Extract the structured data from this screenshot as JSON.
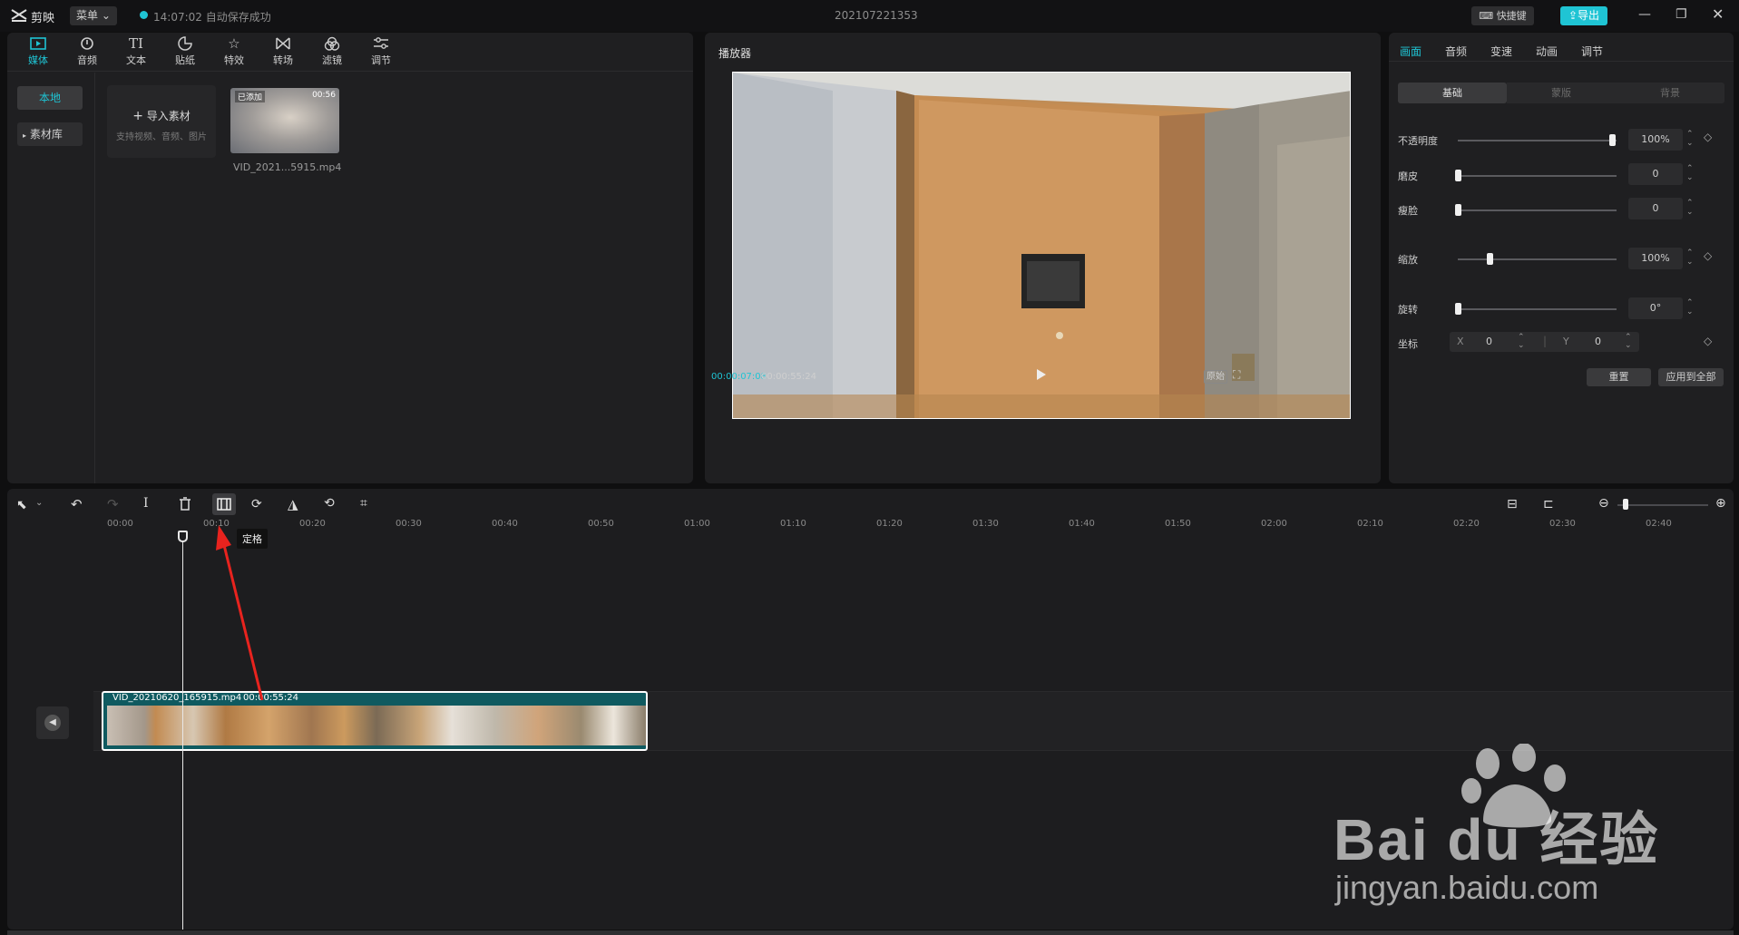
{
  "app": {
    "name": "剪映",
    "menu_label": "菜单",
    "autosave": "14:07:02 自动保存成功",
    "project_name": "202107221353",
    "shortcut_label": "快捷键",
    "export_label": "导出"
  },
  "media_tabs": [
    {
      "label": "媒体",
      "icon": "media-icon"
    },
    {
      "label": "音频",
      "icon": "audio-icon"
    },
    {
      "label": "文本",
      "icon": "text-icon"
    },
    {
      "label": "贴纸",
      "icon": "sticker-icon"
    },
    {
      "label": "特效",
      "icon": "effects-icon"
    },
    {
      "label": "转场",
      "icon": "transition-icon"
    },
    {
      "label": "滤镜",
      "icon": "filter-icon"
    },
    {
      "label": "调节",
      "icon": "adjust-icon"
    }
  ],
  "media_side": {
    "local": "本地",
    "library": "素材库"
  },
  "import": {
    "label": "导入素材",
    "hint": "支持视频、音频、图片"
  },
  "clip_thumb": {
    "badge": "已添加",
    "duration": "00:56",
    "filename": "VID_2021...5915.mp4"
  },
  "player": {
    "title": "播放器",
    "current_time": "00:00:07:08",
    "total_time": "00:00:55:24",
    "ratio_label": "原始"
  },
  "props_tabs": [
    "画面",
    "音频",
    "变速",
    "动画",
    "调节"
  ],
  "props_subtabs": [
    "基础",
    "蒙版",
    "背景"
  ],
  "props": {
    "opacity": {
      "label": "不透明度",
      "value": "100%",
      "level": 1.0
    },
    "smooth": {
      "label": "磨皮",
      "value": "0",
      "level": 0.0
    },
    "slim": {
      "label": "瘦脸",
      "value": "0",
      "level": 0.0
    },
    "scale": {
      "label": "缩放",
      "value": "100%",
      "level": 0.2
    },
    "rotate": {
      "label": "旋转",
      "value": "0°",
      "level": 0.0
    },
    "position": {
      "label": "坐标",
      "x_label": "X",
      "x_value": "0",
      "y_label": "Y",
      "y_value": "0"
    },
    "reset_label": "重置",
    "apply_all_label": "应用到全部"
  },
  "timeline": {
    "ruler": [
      "00:00",
      "00:10",
      "00:20",
      "00:30",
      "00:40",
      "00:50",
      "01:00",
      "01:10",
      "01:20",
      "01:30",
      "01:40",
      "01:50",
      "02:00",
      "02:10",
      "02:20",
      "02:30",
      "02:40"
    ],
    "tooltip": "定格",
    "clip_name": "VID_20210620_165915.mp4",
    "clip_duration": "00:00:55:24"
  },
  "watermark": {
    "brand": "Bai du 经验",
    "url": "jingyan.baidu.com"
  }
}
